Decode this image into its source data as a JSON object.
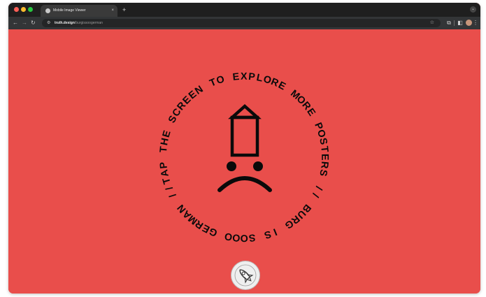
{
  "browser": {
    "tab": {
      "title": "Mobile Image Viewer",
      "close_glyph": "×"
    },
    "new_tab_glyph": "+",
    "menu_glyph": "⌄",
    "url": {
      "host": "truth.design",
      "path": "/burgissoogerman"
    },
    "nav": {
      "back": "←",
      "forward": "→",
      "reload": "↻"
    },
    "icons": {
      "site_info": "tune-icon",
      "bookmark": "star-icon",
      "extension": "puzzle-icon",
      "split": "split-view-icon",
      "more": "kebab-icon"
    }
  },
  "page": {
    "background": "#e94e4b",
    "ring_text": "TAP THE SCREEN TO EXPLORE MORE POSTERS // BURG IS SOOO GERMAN //",
    "logo": "burg-sad-face-logo",
    "badge": "rocket-badge-icon"
  }
}
